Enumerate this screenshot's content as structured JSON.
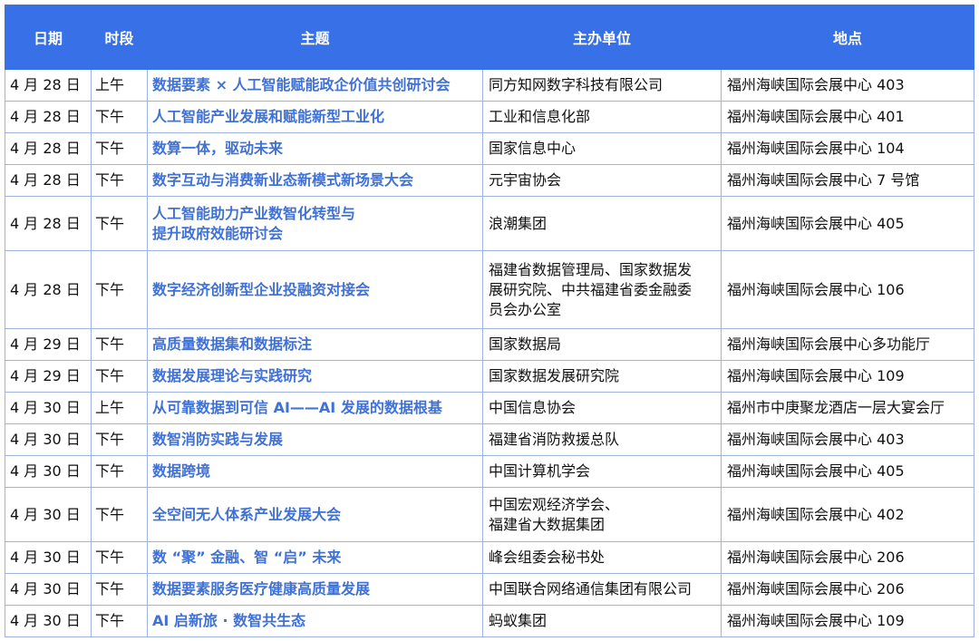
{
  "header": {
    "date": "日期",
    "period": "时段",
    "topic": "主题",
    "organizer": "主办单位",
    "location": "地点"
  },
  "rows": [
    {
      "date": "4 月 28 日",
      "period": "上午",
      "topic": "数据要素 × 人工智能赋能政企价值共创研讨会",
      "organizer": "同方知网数字科技有限公司",
      "location": "福州海峡国际会展中心 403"
    },
    {
      "date": "4 月 28 日",
      "period": "下午",
      "topic": "人工智能产业发展和赋能新型工业化",
      "organizer": "工业和信息化部",
      "location": "福州海峡国际会展中心 401"
    },
    {
      "date": "4 月 28 日",
      "period": "下午",
      "topic": "数算一体，驱动未来",
      "organizer": "国家信息中心",
      "location": "福州海峡国际会展中心 104"
    },
    {
      "date": "4 月 28 日",
      "period": "下午",
      "topic": "数字互动与消费新业态新模式新场景大会",
      "organizer": "元宇宙协会",
      "location": "福州海峡国际会展中心 7 号馆"
    },
    {
      "date": "4 月 28 日",
      "period": "下午",
      "topic": "人工智能助力产业数智化转型与\n提升政府效能研讨会",
      "organizer": "浪潮集团",
      "location": "福州海峡国际会展中心 405"
    },
    {
      "date": "4 月 28 日",
      "period": "下午",
      "topic": "数字经济创新型企业投融资对接会",
      "organizer": "福建省数据管理局、国家数据发\n展研究院、中共福建省委金融委\n员会办公室",
      "location": "福州海峡国际会展中心 106"
    },
    {
      "date": "4 月 29 日",
      "period": "下午",
      "topic": "高质量数据集和数据标注",
      "organizer": "国家数据局",
      "location": "福州海峡国际会展中心多功能厅"
    },
    {
      "date": "4 月 29 日",
      "period": "下午",
      "topic": "数据发展理论与实践研究",
      "organizer": "国家数据发展研究院",
      "location": "福州海峡国际会展中心 109"
    },
    {
      "date": "4 月 30 日",
      "period": "上午",
      "topic": "从可靠数据到可信 AI——AI 发展的数据根基",
      "organizer": "中国信息协会",
      "location": "福州市中庚聚龙酒店一层大宴会厅"
    },
    {
      "date": "4 月 30 日",
      "period": "下午",
      "topic": "数智消防实践与发展",
      "organizer": "福建省消防救援总队",
      "location": "福州海峡国际会展中心 403"
    },
    {
      "date": "4 月 30 日",
      "period": "下午",
      "topic": "数据跨境",
      "organizer": "中国计算机学会",
      "location": "福州海峡国际会展中心 405"
    },
    {
      "date": "4 月 30 日",
      "period": "下午",
      "topic": "全空间无人体系产业发展大会",
      "organizer": "中国宏观经济学会、\n福建省大数据集团",
      "location": "福州海峡国际会展中心 402"
    },
    {
      "date": "4 月 30 日",
      "period": "下午",
      "topic": "数 “聚” 金融、智 “启” 未来",
      "organizer": "峰会组委会秘书处",
      "location": "福州海峡国际会展中心 206"
    },
    {
      "date": "4 月 30 日",
      "period": "下午",
      "topic": "数据要素服务医疗健康高质量发展",
      "organizer": "中国联合网络通信集团有限公司",
      "location": "福州海峡国际会展中心 206"
    },
    {
      "date": "4 月 30 日",
      "period": "下午",
      "topic": "AI 启新旅 · 数智共生态",
      "organizer": "蚂蚁集团",
      "location": "福州海峡国际会展中心 109"
    }
  ]
}
